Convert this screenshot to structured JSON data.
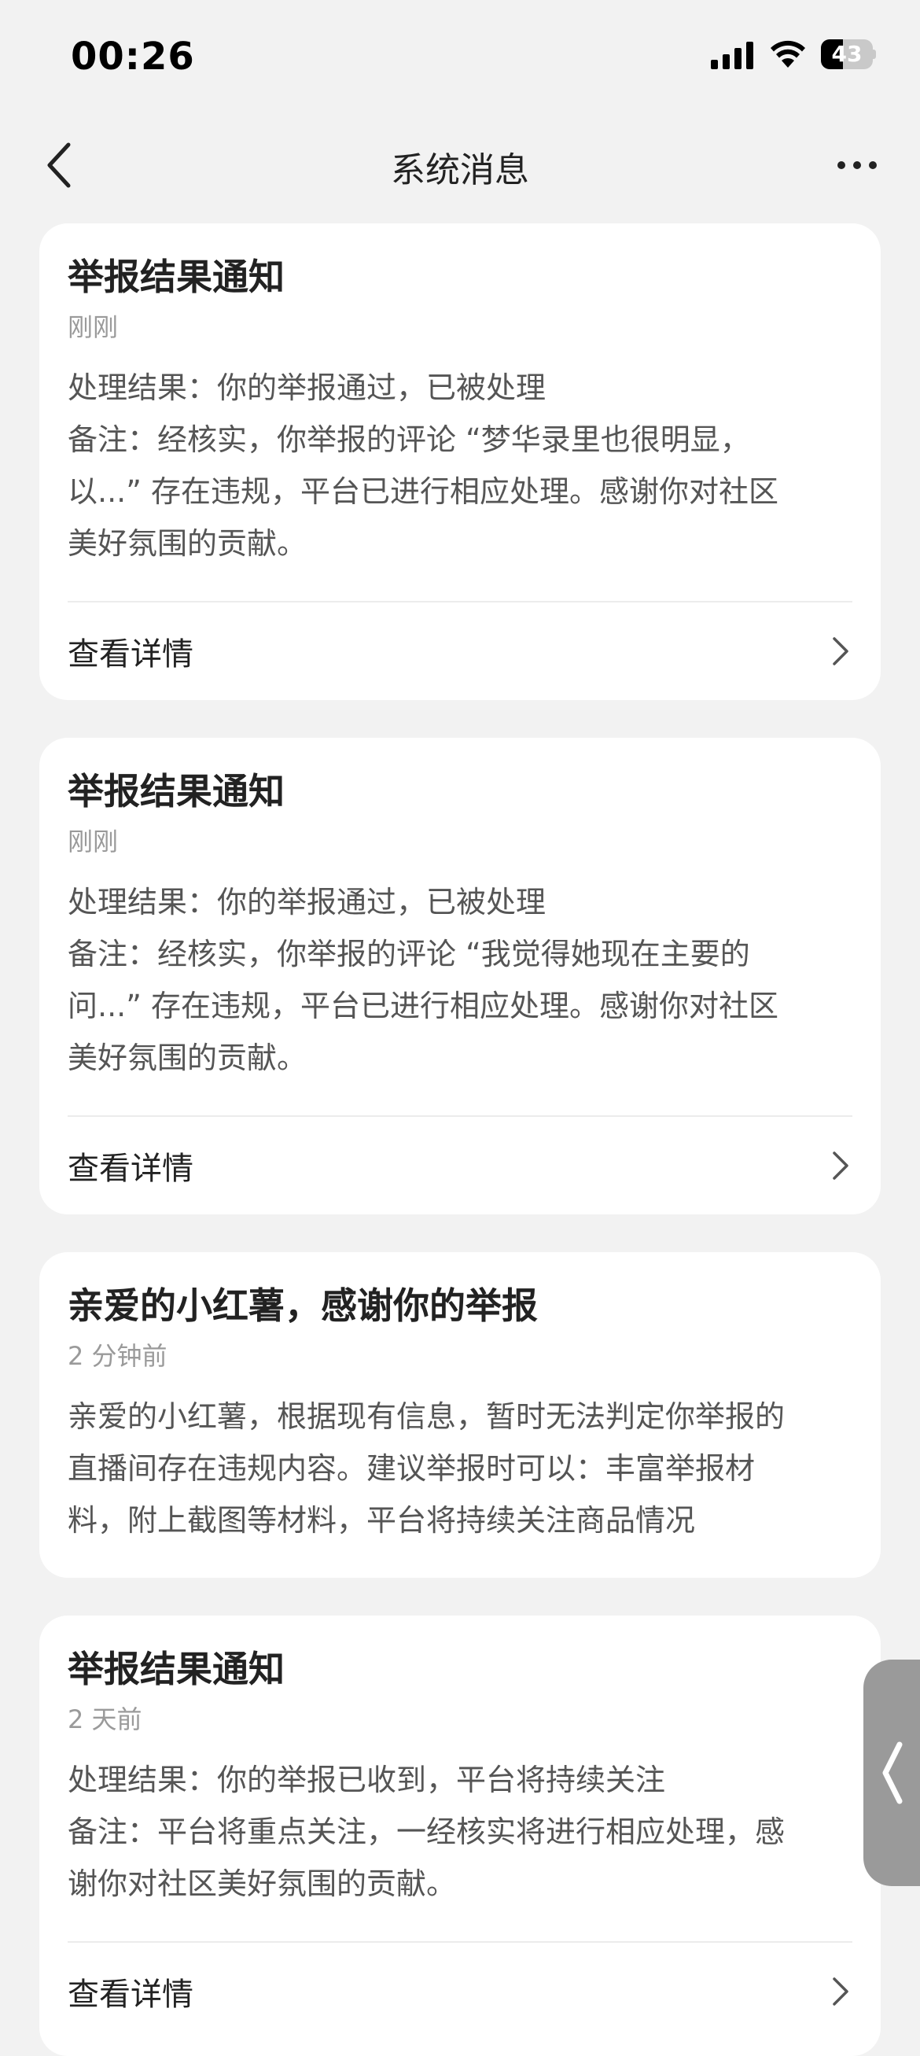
{
  "status_bar": {
    "time": "00:26",
    "battery": "43",
    "battery_level": 0.43
  },
  "nav": {
    "title": "系统消息"
  },
  "messages": [
    {
      "title": "举报结果通知",
      "time": "刚刚",
      "body": [
        "处理结果：你的举报通过，已被处理",
        "备注：经核实，你举报的评论 “梦华录里也很明显，",
        "以...” 存在违规，平台已进行相应处理。感谢你对社区",
        "美好氛围的贡献。"
      ],
      "action": "查看详情"
    },
    {
      "title": "举报结果通知",
      "time": "刚刚",
      "body": [
        "处理结果：你的举报通过，已被处理",
        "备注：经核实，你举报的评论 “我觉得她现在主要的",
        "问...” 存在违规，平台已进行相应处理。感谢你对社区",
        "美好氛围的贡献。"
      ],
      "action": "查看详情"
    },
    {
      "title": "亲爱的小红薯，感谢你的举报",
      "time": "2 分钟前",
      "body": [
        "亲爱的小红薯，根据现有信息，暂时无法判定你举报的",
        "直播间存在违规内容。建议举报时可以：丰富举报材",
        "料，附上截图等材料，平台将持续关注商品情况"
      ]
    },
    {
      "title": "举报结果通知",
      "time": "2 天前",
      "body": [
        "处理结果：你的举报已收到，平台将持续关注",
        "备注：平台将重点关注，一经核实将进行相应处理，感",
        "谢你对社区美好氛围的贡献。"
      ],
      "action": "查看详情"
    }
  ],
  "icons": {
    "back": "chevron-left-icon",
    "more": "more-icon",
    "chevron": "chevron-right-icon",
    "side_tab": "chevron-left-icon"
  },
  "colors": {
    "background": "#f2f2f2",
    "card": "#ffffff",
    "title": "#222222",
    "secondary": "#9a9a9a",
    "body": "#555555"
  }
}
